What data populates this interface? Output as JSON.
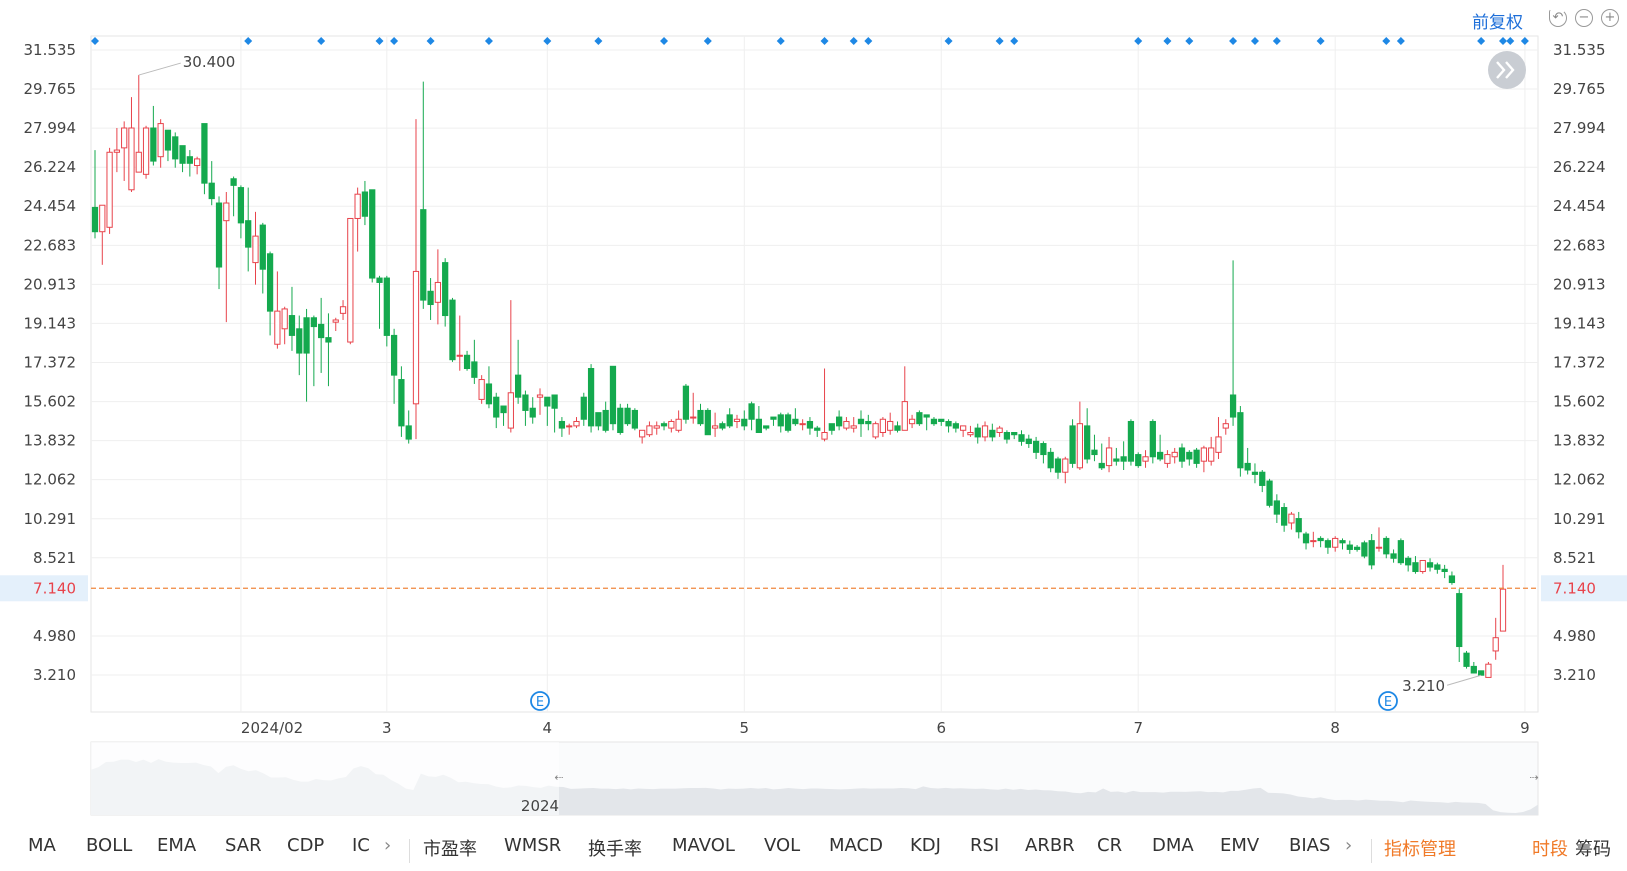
{
  "header": {
    "adjust_label": "前复权",
    "icons": [
      "undo-icon",
      "zoom-out-icon",
      "zoom-in-icon"
    ]
  },
  "colors": {
    "up": "#e8434b",
    "down": "#14a94e",
    "marker": "#1e88e5",
    "price_line": "#f0883e"
  },
  "chart_data": {
    "type": "candlestick",
    "y_ticks": [
      "31.535",
      "29.765",
      "27.994",
      "26.224",
      "24.454",
      "22.683",
      "20.913",
      "19.143",
      "17.372",
      "15.602",
      "13.832",
      "12.062",
      "10.291",
      "8.521",
      "4.980",
      "3.210"
    ],
    "ylim": [
      3.21,
      31.535
    ],
    "x_labels": [
      "2024/02",
      "3",
      "4",
      "5",
      "6",
      "7",
      "8",
      "9"
    ],
    "current_price": "7.140",
    "annotations": {
      "high": "30.400",
      "low": "3.210"
    },
    "navigator_label": "2024",
    "event_markers": [
      "E",
      "E"
    ],
    "candles": [
      [
        24.4,
        23.3,
        27.0,
        23.0
      ],
      [
        23.3,
        24.5,
        24.5,
        21.8
      ],
      [
        23.5,
        26.9,
        27.1,
        23.2
      ],
      [
        26.9,
        27.0,
        28.0,
        26.0
      ],
      [
        27.1,
        28.0,
        28.3,
        25.6
      ],
      [
        25.2,
        28.0,
        29.4,
        25.1
      ],
      [
        26.0,
        26.9,
        30.4,
        26.8
      ],
      [
        25.9,
        28.0,
        28.1,
        25.7
      ],
      [
        28.0,
        26.5,
        29.0,
        26.3
      ],
      [
        26.7,
        28.2,
        28.4,
        26.2
      ],
      [
        27.9,
        27.0,
        27.9,
        26.5
      ],
      [
        27.6,
        26.6,
        27.8,
        26.2
      ],
      [
        27.2,
        26.4,
        27.2,
        26.0
      ],
      [
        26.7,
        26.4,
        27.0,
        25.8
      ],
      [
        26.3,
        26.6,
        26.7,
        25.9
      ],
      [
        28.2,
        25.5,
        28.2,
        25.0
      ],
      [
        25.5,
        24.8,
        26.5,
        24.5
      ],
      [
        24.6,
        21.7,
        24.9,
        20.7
      ],
      [
        23.8,
        24.6,
        25.1,
        19.2
      ],
      [
        25.7,
        25.4,
        25.8,
        24.0
      ],
      [
        25.3,
        23.7,
        25.4,
        23.0
      ],
      [
        23.8,
        22.6,
        25.3,
        21.5
      ],
      [
        21.9,
        23.1,
        24.2,
        20.9
      ],
      [
        23.6,
        21.6,
        23.7,
        20.5
      ],
      [
        22.3,
        19.7,
        22.4,
        18.6
      ],
      [
        18.2,
        19.7,
        21.5,
        18.0
      ],
      [
        18.9,
        19.8,
        19.9,
        18.2
      ],
      [
        19.5,
        18.6,
        20.8,
        17.9
      ],
      [
        18.9,
        17.8,
        19.5,
        16.8
      ],
      [
        19.4,
        17.8,
        19.8,
        15.6
      ],
      [
        19.4,
        19.0,
        19.5,
        16.3
      ],
      [
        19.1,
        18.5,
        20.3,
        16.9
      ],
      [
        18.5,
        18.3,
        19.6,
        16.3
      ],
      [
        19.2,
        19.3,
        19.4,
        18.8
      ],
      [
        19.6,
        19.9,
        20.2,
        19.3
      ],
      [
        18.3,
        23.9,
        23.9,
        18.2
      ],
      [
        23.9,
        25.0,
        25.3,
        22.4
      ],
      [
        25.1,
        24.0,
        25.6,
        23.6
      ],
      [
        25.2,
        21.2,
        25.2,
        21.0
      ],
      [
        21.2,
        21.0,
        21.3,
        18.9
      ],
      [
        21.2,
        18.6,
        21.3,
        18.1
      ],
      [
        18.6,
        16.8,
        18.9,
        15.5
      ],
      [
        16.6,
        14.5,
        17.2,
        14.0
      ],
      [
        14.5,
        13.9,
        15.2,
        13.7
      ],
      [
        15.5,
        21.5,
        28.4,
        13.9
      ],
      [
        24.3,
        20.2,
        30.1,
        19.8
      ],
      [
        20.6,
        20.0,
        21.2,
        19.3
      ],
      [
        20.1,
        21.0,
        22.5,
        19.1
      ],
      [
        21.9,
        19.5,
        22.1,
        19.0
      ],
      [
        20.2,
        17.5,
        20.3,
        17.4
      ],
      [
        17.7,
        17.7,
        19.5,
        17.0
      ],
      [
        17.7,
        17.1,
        17.9,
        17.0
      ],
      [
        17.4,
        16.7,
        18.4,
        16.4
      ],
      [
        15.7,
        16.6,
        16.8,
        15.5
      ],
      [
        16.4,
        15.5,
        17.2,
        15.3
      ],
      [
        15.8,
        14.9,
        16.0,
        14.4
      ],
      [
        15.4,
        15.1,
        15.4,
        14.5
      ],
      [
        14.4,
        16.0,
        20.2,
        14.2
      ],
      [
        16.8,
        15.8,
        18.4,
        15.5
      ],
      [
        15.9,
        15.2,
        16.1,
        14.5
      ],
      [
        15.3,
        14.9,
        15.8,
        14.6
      ],
      [
        15.8,
        15.9,
        16.2,
        15.0
      ],
      [
        15.8,
        15.4,
        15.8,
        14.5
      ],
      [
        15.9,
        15.3,
        15.9,
        14.2
      ],
      [
        14.7,
        14.4,
        14.9,
        14.0
      ],
      [
        14.5,
        14.5,
        14.6,
        14.1
      ],
      [
        14.5,
        14.7,
        14.9,
        14.4
      ],
      [
        15.8,
        14.8,
        16.0,
        14.5
      ],
      [
        17.1,
        14.5,
        17.3,
        14.2
      ],
      [
        15.1,
        14.5,
        15.1,
        14.3
      ],
      [
        15.2,
        14.3,
        15.6,
        14.2
      ],
      [
        17.2,
        14.6,
        17.2,
        14.3
      ],
      [
        15.3,
        14.2,
        15.5,
        14.1
      ],
      [
        15.3,
        14.6,
        15.5,
        14.5
      ],
      [
        15.2,
        14.4,
        15.3,
        14.3
      ],
      [
        14.0,
        14.3,
        14.3,
        13.7
      ],
      [
        14.1,
        14.5,
        14.7,
        14.0
      ],
      [
        14.4,
        14.5,
        14.7,
        14.1
      ],
      [
        14.6,
        14.5,
        14.7,
        14.3
      ],
      [
        14.4,
        14.7,
        14.8,
        14.2
      ],
      [
        14.3,
        14.8,
        15.2,
        14.2
      ],
      [
        16.3,
        14.8,
        16.4,
        14.6
      ],
      [
        14.9,
        14.9,
        16.0,
        14.6
      ],
      [
        15.2,
        14.6,
        15.5,
        14.5
      ],
      [
        15.2,
        14.1,
        15.3,
        14.1
      ],
      [
        14.4,
        14.5,
        15.1,
        14.0
      ],
      [
        14.6,
        14.4,
        14.7,
        14.3
      ],
      [
        15.0,
        14.5,
        15.3,
        14.4
      ],
      [
        14.7,
        14.8,
        15.0,
        14.4
      ],
      [
        14.8,
        14.5,
        15.2,
        14.3
      ],
      [
        15.5,
        14.8,
        15.6,
        14.3
      ],
      [
        14.8,
        14.2,
        15.4,
        14.2
      ],
      [
        14.5,
        14.4,
        14.5,
        14.3
      ],
      [
        14.9,
        14.8,
        14.9,
        14.5
      ],
      [
        15.0,
        14.5,
        15.1,
        14.2
      ],
      [
        15.0,
        14.3,
        15.1,
        14.2
      ],
      [
        14.8,
        14.6,
        15.3,
        14.5
      ],
      [
        14.6,
        14.6,
        14.8,
        14.3
      ],
      [
        14.7,
        14.4,
        14.9,
        14.1
      ],
      [
        14.4,
        14.3,
        14.5,
        14.0
      ],
      [
        13.9,
        14.2,
        17.1,
        13.8
      ],
      [
        14.6,
        14.3,
        14.6,
        14.1
      ],
      [
        14.9,
        14.5,
        15.2,
        14.3
      ],
      [
        14.4,
        14.7,
        14.9,
        14.3
      ],
      [
        14.4,
        14.5,
        14.9,
        14.2
      ],
      [
        14.8,
        14.6,
        15.2,
        14.0
      ],
      [
        14.7,
        14.6,
        15.0,
        14.3
      ],
      [
        14.0,
        14.6,
        14.7,
        13.9
      ],
      [
        14.2,
        14.8,
        14.9,
        14.0
      ],
      [
        14.3,
        14.7,
        15.1,
        14.1
      ],
      [
        14.5,
        14.3,
        14.7,
        14.2
      ],
      [
        14.3,
        15.6,
        17.2,
        14.3
      ],
      [
        14.6,
        14.8,
        15.0,
        14.4
      ],
      [
        15.1,
        14.6,
        15.2,
        14.5
      ],
      [
        15.0,
        14.9,
        15.0,
        14.3
      ],
      [
        14.8,
        14.6,
        14.9,
        14.5
      ],
      [
        14.8,
        14.7,
        14.8,
        14.5
      ],
      [
        14.7,
        14.5,
        14.8,
        14.2
      ],
      [
        14.6,
        14.4,
        14.7,
        14.2
      ],
      [
        14.3,
        14.5,
        14.5,
        14.0
      ],
      [
        14.1,
        14.2,
        14.5,
        14.0
      ],
      [
        14.4,
        14.0,
        14.6,
        13.7
      ],
      [
        14.0,
        14.5,
        14.7,
        13.8
      ],
      [
        14.3,
        14.0,
        14.6,
        13.8
      ],
      [
        14.2,
        14.4,
        14.5,
        14.0
      ],
      [
        14.2,
        13.9,
        14.3,
        13.7
      ],
      [
        14.2,
        14.1,
        14.2,
        13.9
      ],
      [
        14.1,
        13.8,
        14.3,
        13.6
      ],
      [
        13.9,
        13.7,
        14.1,
        13.5
      ],
      [
        13.8,
        13.3,
        14.0,
        13.0
      ],
      [
        13.7,
        13.2,
        13.8,
        12.8
      ],
      [
        13.3,
        12.6,
        13.5,
        12.4
      ],
      [
        13.0,
        12.4,
        13.1,
        12.1
      ],
      [
        12.4,
        13.0,
        13.1,
        11.9
      ],
      [
        14.5,
        12.8,
        14.8,
        12.6
      ],
      [
        12.6,
        14.6,
        15.6,
        12.5
      ],
      [
        14.5,
        13.0,
        15.3,
        12.8
      ],
      [
        13.4,
        13.2,
        14.1,
        12.9
      ],
      [
        12.8,
        12.6,
        13.7,
        12.5
      ],
      [
        12.7,
        13.5,
        14.0,
        12.4
      ],
      [
        13.0,
        12.9,
        13.5,
        12.7
      ],
      [
        13.1,
        12.9,
        13.8,
        12.5
      ],
      [
        14.7,
        12.9,
        14.8,
        12.7
      ],
      [
        13.2,
        12.7,
        13.3,
        12.6
      ],
      [
        12.9,
        13.1,
        13.4,
        12.6
      ],
      [
        14.7,
        13.1,
        14.8,
        12.8
      ],
      [
        13.3,
        13.0,
        14.1,
        12.9
      ],
      [
        12.8,
        13.2,
        13.4,
        12.6
      ],
      [
        13.1,
        13.3,
        13.5,
        12.8
      ],
      [
        13.5,
        12.9,
        13.7,
        12.6
      ],
      [
        13.3,
        13.0,
        13.4,
        12.7
      ],
      [
        13.4,
        12.8,
        13.5,
        12.6
      ],
      [
        12.9,
        13.5,
        13.6,
        12.4
      ],
      [
        12.9,
        13.5,
        14.0,
        12.7
      ],
      [
        13.3,
        14.0,
        14.9,
        13.0
      ],
      [
        14.4,
        14.6,
        14.8,
        14.1
      ],
      [
        15.9,
        14.9,
        22.0,
        14.5
      ],
      [
        15.1,
        12.6,
        15.4,
        12.2
      ],
      [
        12.8,
        12.5,
        13.5,
        12.3
      ],
      [
        12.4,
        12.3,
        12.8,
        11.9
      ],
      [
        12.4,
        11.8,
        12.5,
        11.5
      ],
      [
        12.0,
        10.9,
        12.1,
        10.8
      ],
      [
        11.1,
        10.5,
        11.4,
        10.1
      ],
      [
        10.8,
        10.0,
        11.0,
        9.7
      ],
      [
        10.1,
        10.5,
        10.6,
        9.8
      ],
      [
        10.3,
        9.7,
        10.6,
        9.4
      ],
      [
        9.6,
        9.2,
        9.7,
        8.9
      ],
      [
        9.3,
        9.3,
        9.7,
        9.0
      ],
      [
        9.4,
        9.3,
        9.5,
        9.0
      ],
      [
        9.3,
        9.0,
        9.4,
        8.7
      ],
      [
        9.0,
        9.4,
        9.5,
        8.8
      ],
      [
        9.3,
        9.2,
        9.4,
        8.9
      ],
      [
        9.1,
        8.9,
        9.3,
        8.7
      ],
      [
        9.0,
        8.9,
        9.1,
        8.8
      ],
      [
        9.2,
        8.6,
        9.3,
        8.5
      ],
      [
        9.3,
        8.2,
        9.6,
        8.0
      ],
      [
        9.0,
        9.0,
        9.9,
        8.8
      ],
      [
        9.4,
        8.7,
        9.5,
        8.5
      ],
      [
        8.7,
        8.5,
        8.9,
        8.3
      ],
      [
        9.3,
        8.3,
        9.4,
        8.2
      ],
      [
        8.5,
        8.2,
        8.6,
        7.9
      ],
      [
        8.3,
        7.9,
        8.6,
        7.8
      ],
      [
        7.9,
        8.4,
        8.4,
        7.8
      ],
      [
        8.3,
        8.1,
        8.5,
        7.9
      ],
      [
        8.2,
        8.0,
        8.3,
        7.8
      ],
      [
        8.0,
        7.9,
        8.2,
        7.6
      ],
      [
        7.7,
        7.4,
        7.9,
        7.3
      ],
      [
        6.9,
        4.5,
        7.1,
        3.8
      ],
      [
        4.2,
        3.6,
        4.3,
        3.5
      ],
      [
        3.6,
        3.3,
        3.8,
        3.3
      ],
      [
        3.4,
        3.2,
        3.4,
        3.2
      ],
      [
        3.1,
        3.7,
        3.8,
        3.2
      ],
      [
        4.3,
        4.9,
        5.8,
        3.9
      ],
      [
        5.2,
        7.1,
        8.2,
        5.2
      ]
    ]
  },
  "toolbar": {
    "indicators_left": [
      "MA",
      "BOLL",
      "EMA",
      "SAR",
      "CDP",
      "IC"
    ],
    "indicators_right": [
      "市盈率",
      "WMSR",
      "换手率",
      "MAVOL",
      "VOL",
      "MACD",
      "KDJ",
      "RSI",
      "ARBR",
      "CR",
      "DMA",
      "EMV",
      "BIAS"
    ],
    "manage": "指标管理",
    "tab_time": "时段",
    "tab_chips": "筹码"
  }
}
